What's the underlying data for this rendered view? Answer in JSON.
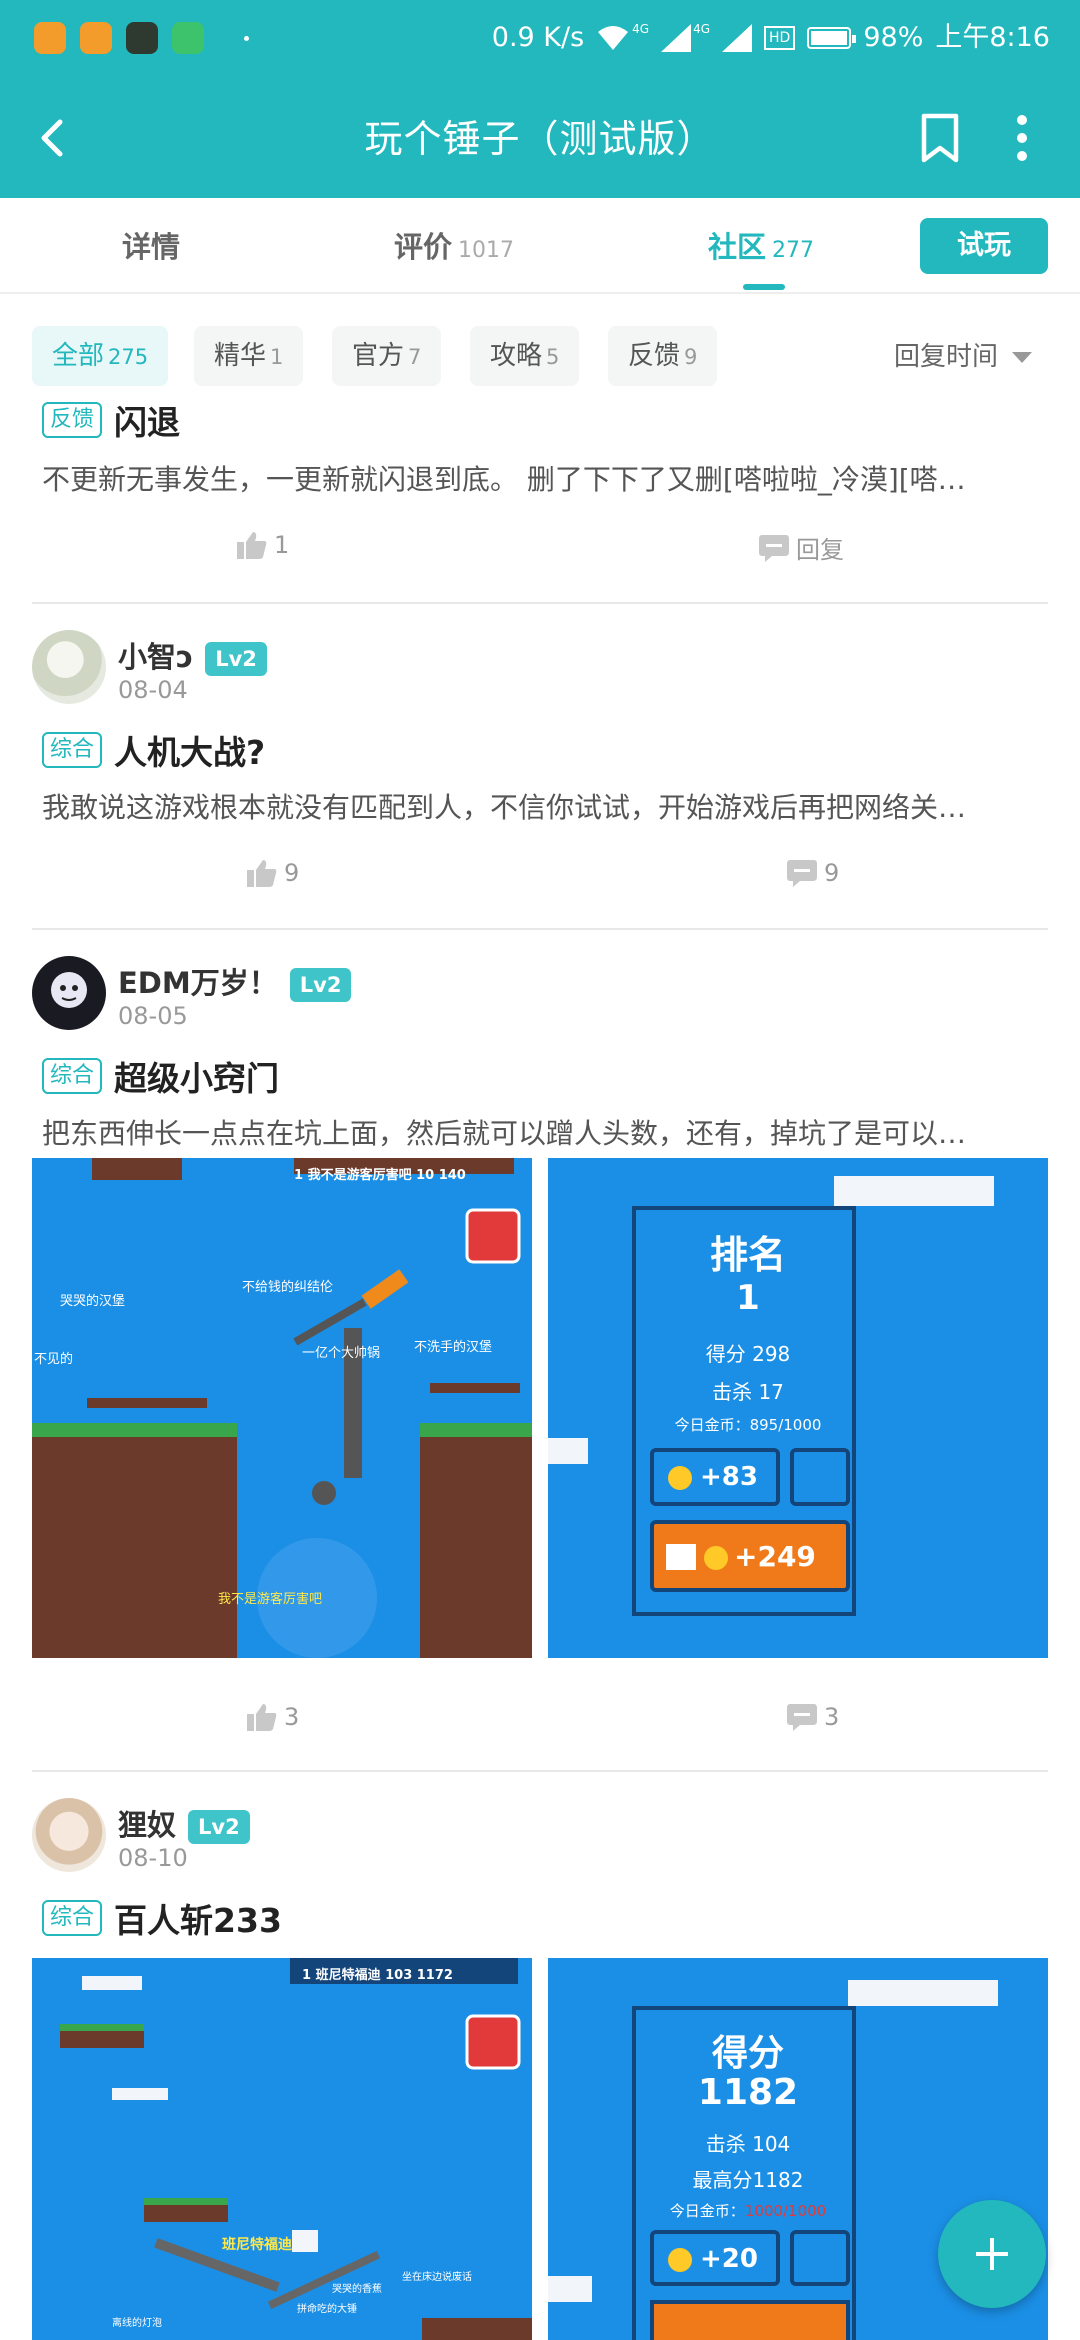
{
  "status_bar": {
    "network_speed": "0.9 K/s",
    "net_4g_a": "4G",
    "net_4g_b": "4G",
    "hd": "HD",
    "battery": "98%",
    "time": "上午8:16"
  },
  "header": {
    "title": "玩个锤子（测试版）"
  },
  "tabs": [
    {
      "label": "详情",
      "count": ""
    },
    {
      "label": "评价",
      "count": "1017"
    },
    {
      "label": "社区",
      "count": "277"
    }
  ],
  "try_button": "试玩",
  "filters": [
    {
      "label": "全部",
      "count": "275"
    },
    {
      "label": "精华",
      "count": "1"
    },
    {
      "label": "官方",
      "count": "7"
    },
    {
      "label": "攻略",
      "count": "5"
    },
    {
      "label": "反馈",
      "count": "9"
    }
  ],
  "sort_label": "回复时间",
  "posts": [
    {
      "tag": "反馈",
      "title": "闪退",
      "excerpt": "不更新无事发生，一更新就闪退到底。 删了下下了又删[嗒啦啦_冷漠][嗒…",
      "likes": "1",
      "replies": "回复"
    },
    {
      "user": "小智ↄ",
      "level": "Lv2",
      "date": "08-04",
      "tag": "综合",
      "title": "人机大战?",
      "excerpt": "我敢说这游戏根本就没有匹配到人，不信你试试，开始游戏后再把网络关…",
      "likes": "9",
      "replies": "9"
    },
    {
      "user": "EDM万岁！",
      "level": "Lv2",
      "date": "08-05",
      "tag": "综合",
      "title": "超级小窍门",
      "excerpt": "把东西伸长一点点在坑上面，然后就可以蹭人头数，还有，掉坑了是可以…",
      "likes": "3",
      "replies": "3",
      "shot1": {
        "scoreboard": "1  我不是游客厉害吧  10  140",
        "names": [
          "哭哭的汉堡",
          "不给钱的纠结伦",
          "一亿个大帅锅",
          "不洗手的汉堡",
          "不见的",
          "我不是游客厉害吧"
        ]
      },
      "shot2": {
        "heading": "排名",
        "rank": "1",
        "score": "得分 298",
        "kills": "击杀 17",
        "coins": "今日金币：895/1000",
        "reward1": "+83",
        "reward2": "+249"
      }
    },
    {
      "user": "狸奴",
      "level": "Lv2",
      "date": "08-10",
      "tag": "综合",
      "title": "百人斩233",
      "shot1": {
        "scoreboard": "1  班尼特福迪  103  1172",
        "names": [
          "班尼特福迪",
          "哭哭的香蕉",
          "坐在床边说废话",
          "拼命吃的大锤",
          "离线的灯泡"
        ]
      },
      "shot2": {
        "heading": "得分",
        "score_value": "1182",
        "kills": "击杀 104",
        "best": "最高分1182",
        "coins_label": "今日金币：",
        "coins_value": "1000/1000",
        "reward1": "+20"
      }
    }
  ],
  "colors": {
    "primary": "#22b8bd",
    "sky": "#1b8fe6",
    "orange": "#f07a1a"
  }
}
